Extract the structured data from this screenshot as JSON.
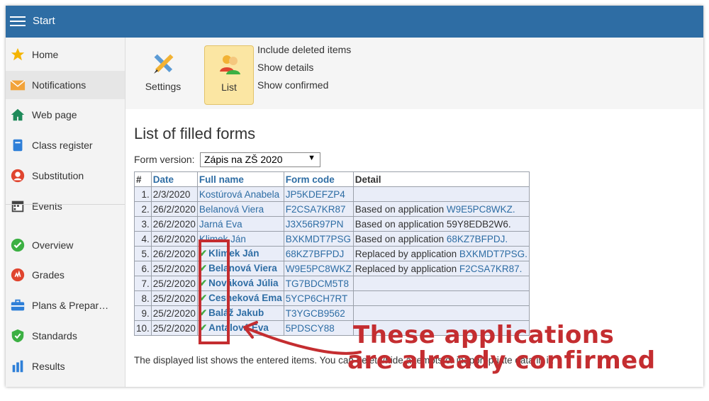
{
  "header": {
    "title": "Start",
    "accent": "#2e6da4"
  },
  "sidebar": {
    "items": [
      {
        "label": "Home",
        "icon": "star-icon",
        "active": false
      },
      {
        "label": "Notifications",
        "icon": "envelope-icon",
        "active": true
      },
      {
        "label": "Web page",
        "icon": "house-icon",
        "active": false
      },
      {
        "label": "Class register",
        "icon": "book-icon",
        "active": false
      },
      {
        "label": "Substitution",
        "icon": "person-icon",
        "active": false
      },
      {
        "label": "Events",
        "icon": "calendar-icon",
        "active": false
      },
      {
        "label": "Overview",
        "icon": "check-circle-icon",
        "active": false
      },
      {
        "label": "Grades",
        "icon": "grades-icon",
        "active": false
      },
      {
        "label": "Plans & Prepar…",
        "icon": "briefcase-icon",
        "active": false
      },
      {
        "label": "Standards",
        "icon": "shield-icon",
        "active": false
      },
      {
        "label": "Results",
        "icon": "bar-chart-icon",
        "active": false
      }
    ]
  },
  "toolbar": {
    "settings_label": "Settings",
    "list_label": "List",
    "links": [
      "Include deleted items",
      "Show details",
      "Show confirmed"
    ]
  },
  "main": {
    "title": "List of filled forms",
    "form_version_label": "Form version:",
    "form_version_value": "Zápis na ZŠ 2020",
    "columns": [
      "#",
      "Date",
      "Full name",
      "Form code",
      "Detail"
    ],
    "rows": [
      {
        "n": "1.",
        "date": "2/3/2020",
        "name": "Kostúrová Anabela",
        "code": "JP5KDEFZP4",
        "detail_text": "",
        "detail_link": "",
        "confirmed": false
      },
      {
        "n": "2.",
        "date": "26/2/2020",
        "name": "Belanová Viera",
        "code": "F2CSA7KR87",
        "detail_text": "Based on application ",
        "detail_link": "W9E5PC8WKZ.",
        "confirmed": false
      },
      {
        "n": "3.",
        "date": "26/2/2020",
        "name": "Jarná Eva",
        "code": "J3X56R97PN",
        "detail_text": "Based on application 59Y8EDB2W6.",
        "detail_link": "",
        "confirmed": false
      },
      {
        "n": "4.",
        "date": "26/2/2020",
        "name": "Klimek Ján",
        "code": "BXKMDT7PSG",
        "detail_text": "Based on application ",
        "detail_link": "68KZ7BFPDJ.",
        "confirmed": false
      },
      {
        "n": "5.",
        "date": "26/2/2020",
        "name": "Klimek Ján",
        "code": "68KZ7BFPDJ",
        "detail_text": "Replaced by application ",
        "detail_link": "BXKMDT7PSG.",
        "confirmed": true
      },
      {
        "n": "6.",
        "date": "25/2/2020",
        "name": "Belanová Viera",
        "code": "W9E5PC8WKZ",
        "detail_text": "Replaced by application ",
        "detail_link": "F2CSA7KR87.",
        "confirmed": true
      },
      {
        "n": "7.",
        "date": "25/2/2020",
        "name": "Nováková Júlia",
        "code": "TG7BDCM5T8",
        "detail_text": "",
        "detail_link": "",
        "confirmed": true
      },
      {
        "n": "8.",
        "date": "25/2/2020",
        "name": "Cesneková Ema",
        "code": "5YCP6CH7RT",
        "detail_text": "",
        "detail_link": "",
        "confirmed": true
      },
      {
        "n": "9.",
        "date": "25/2/2020",
        "name": "Baláž Jakub",
        "code": "T3YGCB9562",
        "detail_text": "",
        "detail_link": "",
        "confirmed": true
      },
      {
        "n": "10.",
        "date": "25/2/2020",
        "name": "Antalová Eva",
        "code": "5PDSCY88",
        "detail_text": "",
        "detail_link": "",
        "confirmed": true
      }
    ],
    "note": "The displayed list shows the entered items. You can delete/hide attempts or inappropriate data in it."
  },
  "annotation": {
    "line1": "These applications",
    "line2": "are already confirmed",
    "color": "#c42d30"
  }
}
